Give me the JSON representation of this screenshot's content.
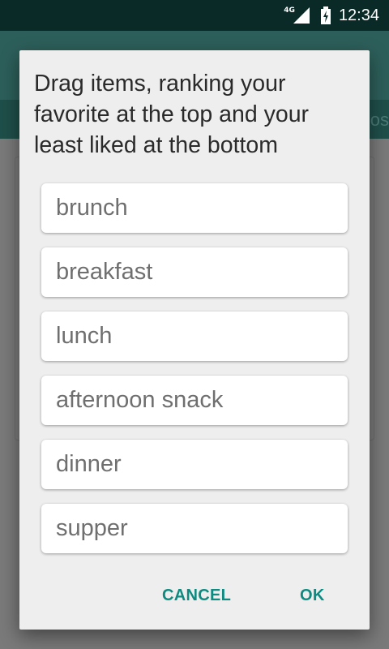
{
  "status_bar": {
    "network": "4G",
    "time": "12:34",
    "signal_icon": "signal-icon",
    "battery_icon": "battery-charging-icon"
  },
  "background_app": {
    "tab_fragment": "os"
  },
  "dialog": {
    "title": "Drag items, ranking your favorite at the top and your least liked at the bottom",
    "items": [
      {
        "label": "brunch"
      },
      {
        "label": "breakfast"
      },
      {
        "label": "lunch"
      },
      {
        "label": "afternoon snack"
      },
      {
        "label": "dinner"
      },
      {
        "label": "supper"
      }
    ],
    "cancel_label": "CANCEL",
    "ok_label": "OK"
  },
  "colors": {
    "accent": "#0f8a80",
    "status_bar": "#0a2a28",
    "toolbar": "#2d5f5a",
    "dialog_bg": "#eeeeee"
  }
}
